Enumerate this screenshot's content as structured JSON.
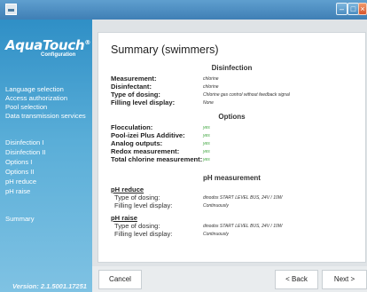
{
  "window": {
    "min": "–",
    "max": "□",
    "close": "×"
  },
  "sidebar": {
    "logo": "AquaTouch",
    "logo_mark": "®",
    "logo_sub": "Configuration",
    "items": [
      "Language selection",
      "Access authorization",
      "Pool selection",
      "Data transmission services",
      "Disinfection I",
      "Disinfection II",
      "Options I",
      "Options II",
      "pH reduce",
      "pH raise",
      "Summary"
    ],
    "version": "Version: 2.1.5001.17251"
  },
  "summary": {
    "title": "Summary (swimmers)",
    "disinfection": {
      "heading": "Disinfection",
      "rows": [
        {
          "label": "Measurement:",
          "value": "chlorine"
        },
        {
          "label": "Disinfectant:",
          "value": "chlorine"
        },
        {
          "label": "Type of dosing:",
          "value": "Chlorine gas control without feedback signal"
        },
        {
          "label": "Filling level display:",
          "value": "None"
        }
      ]
    },
    "options": {
      "heading": "Options",
      "rows": [
        {
          "label": "Flocculation:",
          "value": "yes"
        },
        {
          "label": "Pool-izei Plus Additive:",
          "value": "yes"
        },
        {
          "label": "Analog outputs:",
          "value": "yes"
        },
        {
          "label": "Redox measurement:",
          "value": "yes"
        },
        {
          "label": "Total chlorine measurement:",
          "value": "yes"
        }
      ]
    },
    "ph": {
      "heading": "pH measurement",
      "reduce": {
        "heading": "pH reduce",
        "rows": [
          {
            "label": "Type of dosing:",
            "value": "dinodos START LEVEL BUS, 24V / 10W"
          },
          {
            "label": "Filling level display:",
            "value": "Continuously"
          }
        ]
      },
      "raise": {
        "heading": "pH raise",
        "rows": [
          {
            "label": "Type of dosing:",
            "value": "dinodos START LEVEL BUS, 24V / 10W"
          },
          {
            "label": "Filling level display:",
            "value": "Continuously"
          }
        ]
      }
    }
  },
  "buttons": {
    "cancel": "Cancel",
    "back": "< Back",
    "next": "Next >"
  },
  "colors": {
    "sidebar_top": "#2f8fc6",
    "sidebar_bottom": "#7fc2e3",
    "value_green": "#3aa33a"
  }
}
